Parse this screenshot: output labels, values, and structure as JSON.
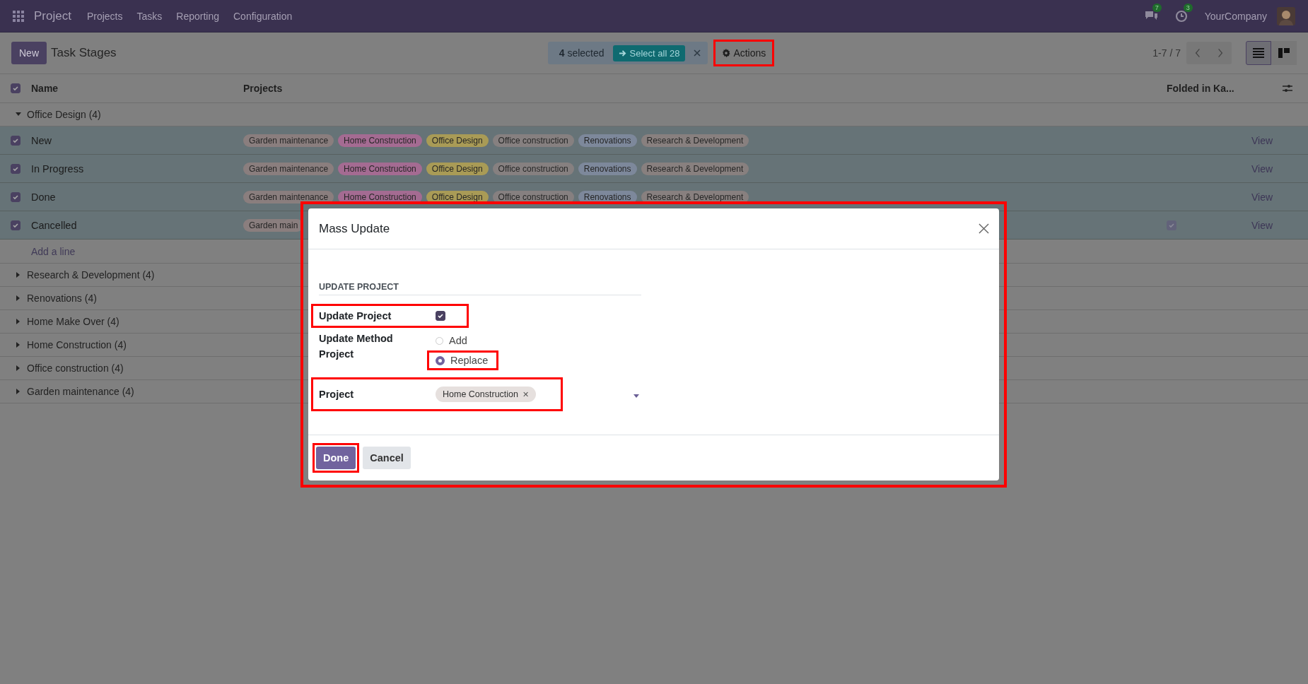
{
  "navbar": {
    "app_name": "Project",
    "menus": [
      "Projects",
      "Tasks",
      "Reporting",
      "Configuration"
    ],
    "messages_count": "7",
    "activities_count": "3",
    "company": "YourCompany"
  },
  "control_panel": {
    "new_button": "New",
    "title": "Task Stages",
    "selection": "**4** selected",
    "select_all": "Select all 28",
    "actions": {
      "label": "Actions",
      "highlighted": true
    },
    "pager": "1-7 / 7",
    "views": [
      {
        "kind": "list",
        "selected": true
      },
      {
        "kind": "kanban",
        "selected": false
      }
    ]
  },
  "table": {
    "all_checked": true,
    "columns": [
      "Name",
      "Projects",
      "Folded in Ka..."
    ],
    "groups": [
      {
        "label": "Office Design (4)",
        "expanded": true,
        "add_line": "Add a line",
        "rows": [
          {
            "name": "New",
            "checked": true,
            "folded": false,
            "action": "View",
            "tags": [
              {
                "label": "Garden maintenance",
                "color": "#8a7e7e"
              },
              {
                "label": "Home Construction",
                "color": "#a46b92"
              },
              {
                "label": "Office Design",
                "color": "#a99b56"
              },
              {
                "label": "Office construction",
                "color": "#868080"
              },
              {
                "label": "Renovations",
                "color": "#7d889b"
              },
              {
                "label": "Research & Development",
                "color": "#88807f"
              }
            ]
          },
          {
            "name": "In Progress",
            "checked": true,
            "folded": false,
            "action": "View",
            "tags": [
              {
                "label": "Garden maintenance",
                "color": "#8a7e7e"
              },
              {
                "label": "Home Construction",
                "color": "#a46b92"
              },
              {
                "label": "Office Design",
                "color": "#a99b56"
              },
              {
                "label": "Office construction",
                "color": "#868080"
              },
              {
                "label": "Renovations",
                "color": "#7d889b"
              },
              {
                "label": "Research & Development",
                "color": "#88807f"
              }
            ]
          },
          {
            "name": "Done",
            "checked": true,
            "folded": false,
            "action": "View",
            "tags": [
              {
                "label": "Garden maintenance",
                "color": "#8a7e7e"
              },
              {
                "label": "Home Construction",
                "color": "#a46b92"
              },
              {
                "label": "Office Design",
                "color": "#a99b56"
              },
              {
                "label": "Office construction",
                "color": "#868080"
              },
              {
                "label": "Renovations",
                "color": "#7d889b"
              },
              {
                "label": "Research & Development",
                "color": "#88807f"
              }
            ]
          },
          {
            "name": "Cancelled",
            "checked": true,
            "folded": true,
            "action": "View",
            "tags": [
              {
                "label": "Garden main",
                "color": "#8a7e7e"
              }
            ]
          }
        ]
      },
      {
        "label": "Research & Development (4)",
        "expanded": false
      },
      {
        "label": "Renovations (4)",
        "expanded": false
      },
      {
        "label": "Home Make Over (4)",
        "expanded": false
      },
      {
        "label": "Home Construction (4)",
        "expanded": false
      },
      {
        "label": "Office construction (4)",
        "expanded": false
      },
      {
        "label": "Garden maintenance (4)",
        "expanded": false
      }
    ]
  },
  "dialog": {
    "title": "Mass Update",
    "highlighted": true,
    "section": "UPDATE PROJECT",
    "update_field": {
      "label": "Update Project",
      "checked": true,
      "highlighted": true
    },
    "method": {
      "label": "Update Method Project",
      "options": [
        {
          "label": "Add",
          "selected": false,
          "highlighted": false
        },
        {
          "label": "Replace",
          "selected": true,
          "highlighted": true
        }
      ]
    },
    "project": {
      "label": "Project",
      "highlighted": true,
      "tags": [
        {
          "label": "Home Construction",
          "remove": "✕"
        }
      ]
    },
    "buttons": [
      {
        "label": "Done",
        "kind": "primary",
        "highlighted": true
      },
      {
        "label": "Cancel",
        "kind": "secondary",
        "highlighted": false
      }
    ]
  }
}
